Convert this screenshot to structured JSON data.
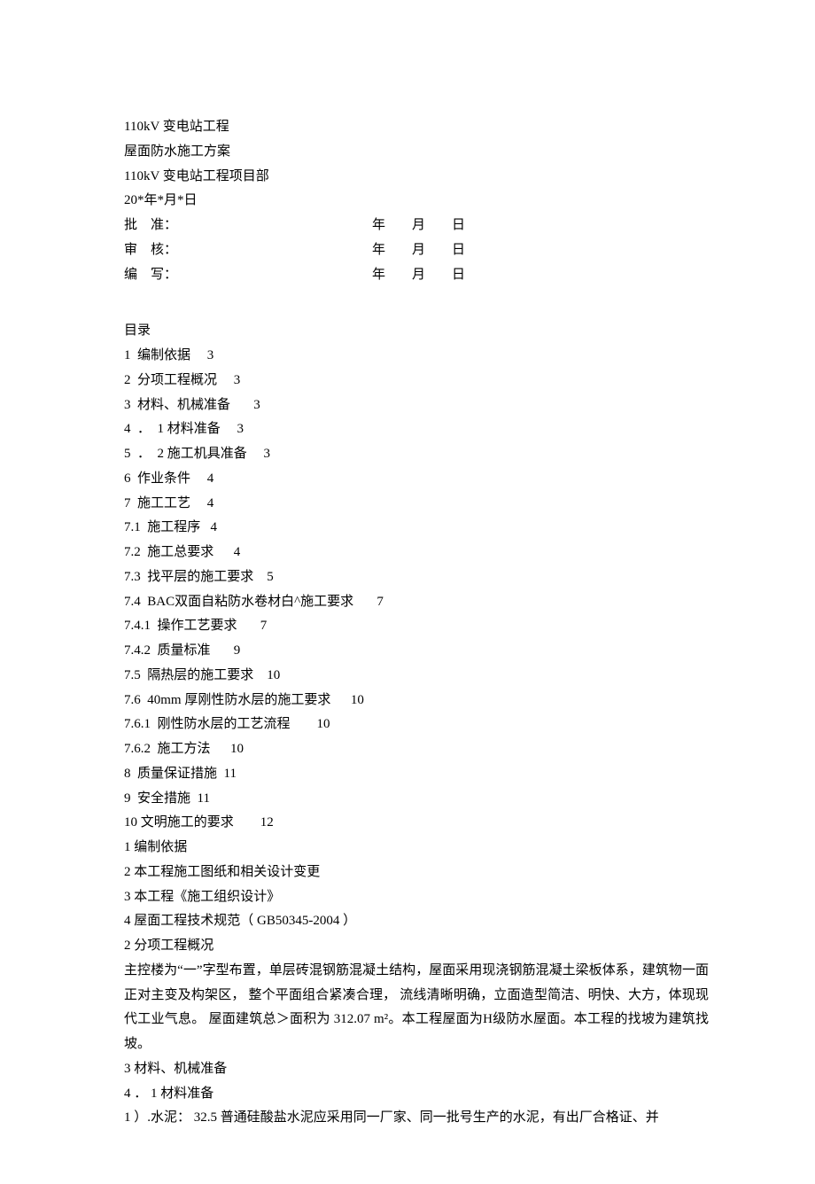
{
  "header": {
    "line1": "110kV 变电站工程",
    "line2": "屋面防水施工方案",
    "line3": "110kV 变电站工程项目部",
    "line4": "20*年*月*日"
  },
  "approvals": [
    {
      "label": "批    准：",
      "date": "年        月        日"
    },
    {
      "label": "审    核：",
      "date": "年        月        日"
    },
    {
      "label": "编    写：",
      "date": "年        月        日"
    }
  ],
  "toc": {
    "heading": "目录",
    "items": [
      "1  编制依据     3",
      "2  分项工程概况     3",
      "3  材料、机械准备       3",
      "4  ．  1 材料准备     3",
      "5  ．  2 施工机具准备     3",
      "6  作业条件     4",
      "7  施工工艺     4",
      "7.1  施工程序   4",
      "7.2  施工总要求      4",
      "7.3  找平层的施工要求    5",
      "7.4  BAC双面自粘防水卷材白^施工要求       7",
      "7.4.1  操作工艺要求       7",
      "7.4.2  质量标准       9",
      "7.5  隔热层的施工要求    10",
      "7.6  40mm 厚刚性防水层的施工要求      10",
      "7.6.1  刚性防水层的工艺流程        10",
      "7.6.2  施工方法      10",
      "8  质量保证措施  11",
      "9  安全措施  11",
      "10 文明施工的要求        12"
    ]
  },
  "body": [
    "1  编制依据",
    "2  本工程施工图纸和相关设计变更",
    "3  本工程《施工组织设计》",
    "4  屋面工程技术规范（ GB50345-2004 ）",
    "2  分项工程概况",
    "主控楼为“一”字型布置，单层砖混钢筋混凝土结构，屋面采用现浇钢筋混凝土梁板体系，建筑物一面正对主变及构架区，  整个平面组合紧凑合理，  流线清晰明确，立面造型简洁、明快、大方，体现现代工业气息。   屋面建筑总＞面积为  312.07 m²。本工程屋面为H级防水屋面。本工程的找坡为建筑找坡。",
    "3  材料、机械准备",
    "4  ．  1 材料准备",
    "1 ）.水泥：       32.5 普通硅酸盐水泥应采用同一厂家、同一批号生产的水泥，有出厂合格证、并"
  ]
}
